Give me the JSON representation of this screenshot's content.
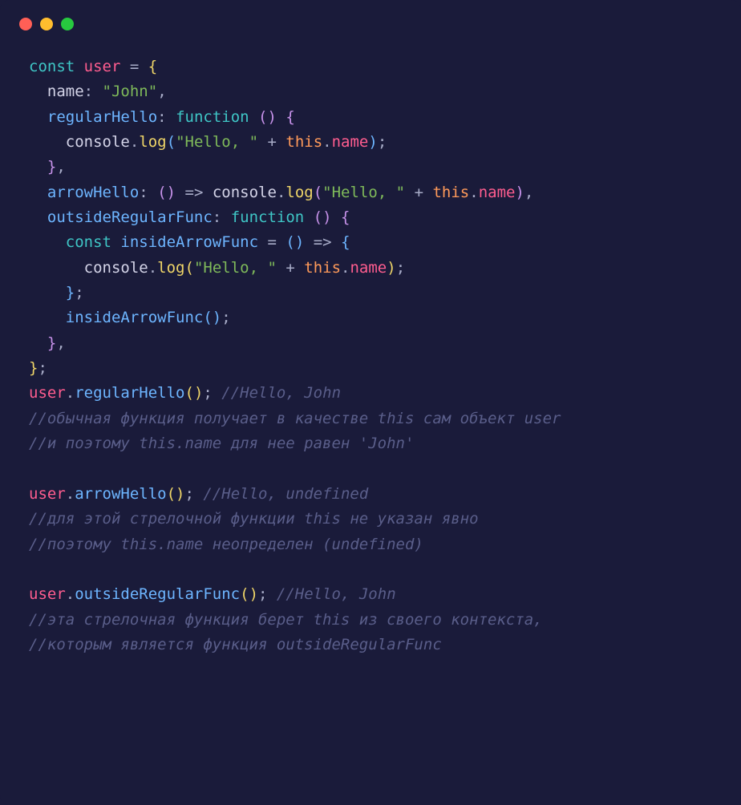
{
  "titlebar": {
    "dots": [
      "red",
      "yellow",
      "green"
    ]
  },
  "code": {
    "lines": [
      [
        {
          "cls": "tok-kw",
          "t": "const"
        },
        {
          "cls": "tok-plain",
          "t": " "
        },
        {
          "cls": "tok-var",
          "t": "user"
        },
        {
          "cls": "tok-plain",
          "t": " "
        },
        {
          "cls": "tok-op",
          "t": "="
        },
        {
          "cls": "tok-plain",
          "t": " "
        },
        {
          "cls": "tok-brace",
          "t": "{"
        }
      ],
      [
        {
          "cls": "tok-plain",
          "t": "  name"
        },
        {
          "cls": "tok-punc",
          "t": ":"
        },
        {
          "cls": "tok-plain",
          "t": " "
        },
        {
          "cls": "tok-str",
          "t": "\"John\""
        },
        {
          "cls": "tok-punc",
          "t": ","
        }
      ],
      [
        {
          "cls": "tok-plain",
          "t": "  "
        },
        {
          "cls": "tok-prop",
          "t": "regularHello"
        },
        {
          "cls": "tok-punc",
          "t": ":"
        },
        {
          "cls": "tok-plain",
          "t": " "
        },
        {
          "cls": "tok-kw",
          "t": "function"
        },
        {
          "cls": "tok-plain",
          "t": " "
        },
        {
          "cls": "tok-paren-p",
          "t": "()"
        },
        {
          "cls": "tok-plain",
          "t": " "
        },
        {
          "cls": "tok-paren-p",
          "t": "{"
        }
      ],
      [
        {
          "cls": "tok-plain",
          "t": "    console"
        },
        {
          "cls": "tok-punc",
          "t": "."
        },
        {
          "cls": "tok-fn",
          "t": "log"
        },
        {
          "cls": "tok-paren-b",
          "t": "("
        },
        {
          "cls": "tok-str",
          "t": "\"Hello, \""
        },
        {
          "cls": "tok-plain",
          "t": " "
        },
        {
          "cls": "tok-op",
          "t": "+"
        },
        {
          "cls": "tok-plain",
          "t": " "
        },
        {
          "cls": "tok-this",
          "t": "this"
        },
        {
          "cls": "tok-punc",
          "t": "."
        },
        {
          "cls": "tok-var",
          "t": "name"
        },
        {
          "cls": "tok-paren-b",
          "t": ")"
        },
        {
          "cls": "tok-punc",
          "t": ";"
        }
      ],
      [
        {
          "cls": "tok-plain",
          "t": "  "
        },
        {
          "cls": "tok-paren-p",
          "t": "}"
        },
        {
          "cls": "tok-punc",
          "t": ","
        }
      ],
      [
        {
          "cls": "tok-plain",
          "t": "  "
        },
        {
          "cls": "tok-prop",
          "t": "arrowHello"
        },
        {
          "cls": "tok-punc",
          "t": ":"
        },
        {
          "cls": "tok-plain",
          "t": " "
        },
        {
          "cls": "tok-paren-p",
          "t": "()"
        },
        {
          "cls": "tok-plain",
          "t": " "
        },
        {
          "cls": "tok-op",
          "t": "=>"
        },
        {
          "cls": "tok-plain",
          "t": " console"
        },
        {
          "cls": "tok-punc",
          "t": "."
        },
        {
          "cls": "tok-fn",
          "t": "log"
        },
        {
          "cls": "tok-paren-p",
          "t": "("
        },
        {
          "cls": "tok-str",
          "t": "\"Hello, \""
        },
        {
          "cls": "tok-plain",
          "t": " "
        },
        {
          "cls": "tok-op",
          "t": "+"
        },
        {
          "cls": "tok-plain",
          "t": " "
        },
        {
          "cls": "tok-this",
          "t": "this"
        },
        {
          "cls": "tok-punc",
          "t": "."
        },
        {
          "cls": "tok-var",
          "t": "name"
        },
        {
          "cls": "tok-paren-p",
          "t": ")"
        },
        {
          "cls": "tok-punc",
          "t": ","
        }
      ],
      [
        {
          "cls": "tok-plain",
          "t": "  "
        },
        {
          "cls": "tok-prop",
          "t": "outsideRegularFunc"
        },
        {
          "cls": "tok-punc",
          "t": ":"
        },
        {
          "cls": "tok-plain",
          "t": " "
        },
        {
          "cls": "tok-kw",
          "t": "function"
        },
        {
          "cls": "tok-plain",
          "t": " "
        },
        {
          "cls": "tok-paren-p",
          "t": "()"
        },
        {
          "cls": "tok-plain",
          "t": " "
        },
        {
          "cls": "tok-paren-p",
          "t": "{"
        }
      ],
      [
        {
          "cls": "tok-plain",
          "t": "    "
        },
        {
          "cls": "tok-kw",
          "t": "const"
        },
        {
          "cls": "tok-plain",
          "t": " "
        },
        {
          "cls": "tok-prop",
          "t": "insideArrowFunc"
        },
        {
          "cls": "tok-plain",
          "t": " "
        },
        {
          "cls": "tok-op",
          "t": "="
        },
        {
          "cls": "tok-plain",
          "t": " "
        },
        {
          "cls": "tok-paren-b",
          "t": "()"
        },
        {
          "cls": "tok-plain",
          "t": " "
        },
        {
          "cls": "tok-op",
          "t": "=>"
        },
        {
          "cls": "tok-plain",
          "t": " "
        },
        {
          "cls": "tok-paren-b",
          "t": "{"
        }
      ],
      [
        {
          "cls": "tok-plain",
          "t": "      console"
        },
        {
          "cls": "tok-punc",
          "t": "."
        },
        {
          "cls": "tok-fn",
          "t": "log"
        },
        {
          "cls": "tok-paren-y",
          "t": "("
        },
        {
          "cls": "tok-str",
          "t": "\"Hello, \""
        },
        {
          "cls": "tok-plain",
          "t": " "
        },
        {
          "cls": "tok-op",
          "t": "+"
        },
        {
          "cls": "tok-plain",
          "t": " "
        },
        {
          "cls": "tok-this",
          "t": "this"
        },
        {
          "cls": "tok-punc",
          "t": "."
        },
        {
          "cls": "tok-var",
          "t": "name"
        },
        {
          "cls": "tok-paren-y",
          "t": ")"
        },
        {
          "cls": "tok-punc",
          "t": ";"
        }
      ],
      [
        {
          "cls": "tok-plain",
          "t": "    "
        },
        {
          "cls": "tok-paren-b",
          "t": "}"
        },
        {
          "cls": "tok-punc",
          "t": ";"
        }
      ],
      [
        {
          "cls": "tok-plain",
          "t": "    "
        },
        {
          "cls": "tok-prop",
          "t": "insideArrowFunc"
        },
        {
          "cls": "tok-paren-b",
          "t": "()"
        },
        {
          "cls": "tok-punc",
          "t": ";"
        }
      ],
      [
        {
          "cls": "tok-plain",
          "t": "  "
        },
        {
          "cls": "tok-paren-p",
          "t": "}"
        },
        {
          "cls": "tok-punc",
          "t": ","
        }
      ],
      [
        {
          "cls": "tok-brace",
          "t": "}"
        },
        {
          "cls": "tok-punc",
          "t": ";"
        }
      ],
      [
        {
          "cls": "tok-var",
          "t": "user"
        },
        {
          "cls": "tok-punc",
          "t": "."
        },
        {
          "cls": "tok-prop",
          "t": "regularHello"
        },
        {
          "cls": "tok-brace",
          "t": "()"
        },
        {
          "cls": "tok-punc",
          "t": ";"
        },
        {
          "cls": "tok-plain",
          "t": " "
        },
        {
          "cls": "tok-comment",
          "t": "//Hello, John"
        }
      ],
      [
        {
          "cls": "tok-comment",
          "t": "//обычная функция получает в качестве this сам объект user"
        }
      ],
      [
        {
          "cls": "tok-comment",
          "t": "//и поэтому this.name для нее равен 'John'"
        }
      ],
      [
        {
          "cls": "tok-plain",
          "t": ""
        }
      ],
      [
        {
          "cls": "tok-var",
          "t": "user"
        },
        {
          "cls": "tok-punc",
          "t": "."
        },
        {
          "cls": "tok-prop",
          "t": "arrowHello"
        },
        {
          "cls": "tok-brace",
          "t": "()"
        },
        {
          "cls": "tok-punc",
          "t": ";"
        },
        {
          "cls": "tok-plain",
          "t": " "
        },
        {
          "cls": "tok-comment",
          "t": "//Hello, undefined"
        }
      ],
      [
        {
          "cls": "tok-comment",
          "t": "//для этой стрелочной функции this не указан явно"
        }
      ],
      [
        {
          "cls": "tok-comment",
          "t": "//поэтому this.name неопределен (undefined)"
        }
      ],
      [
        {
          "cls": "tok-plain",
          "t": ""
        }
      ],
      [
        {
          "cls": "tok-var",
          "t": "user"
        },
        {
          "cls": "tok-punc",
          "t": "."
        },
        {
          "cls": "tok-prop",
          "t": "outsideRegularFunc"
        },
        {
          "cls": "tok-brace",
          "t": "()"
        },
        {
          "cls": "tok-punc",
          "t": ";"
        },
        {
          "cls": "tok-plain",
          "t": " "
        },
        {
          "cls": "tok-comment",
          "t": "//Hello, John"
        }
      ],
      [
        {
          "cls": "tok-comment",
          "t": "//эта стрелочная функция берет this из своего контекста,"
        }
      ],
      [
        {
          "cls": "tok-comment",
          "t": "//которым является функция outsideRegularFunc"
        }
      ]
    ]
  }
}
